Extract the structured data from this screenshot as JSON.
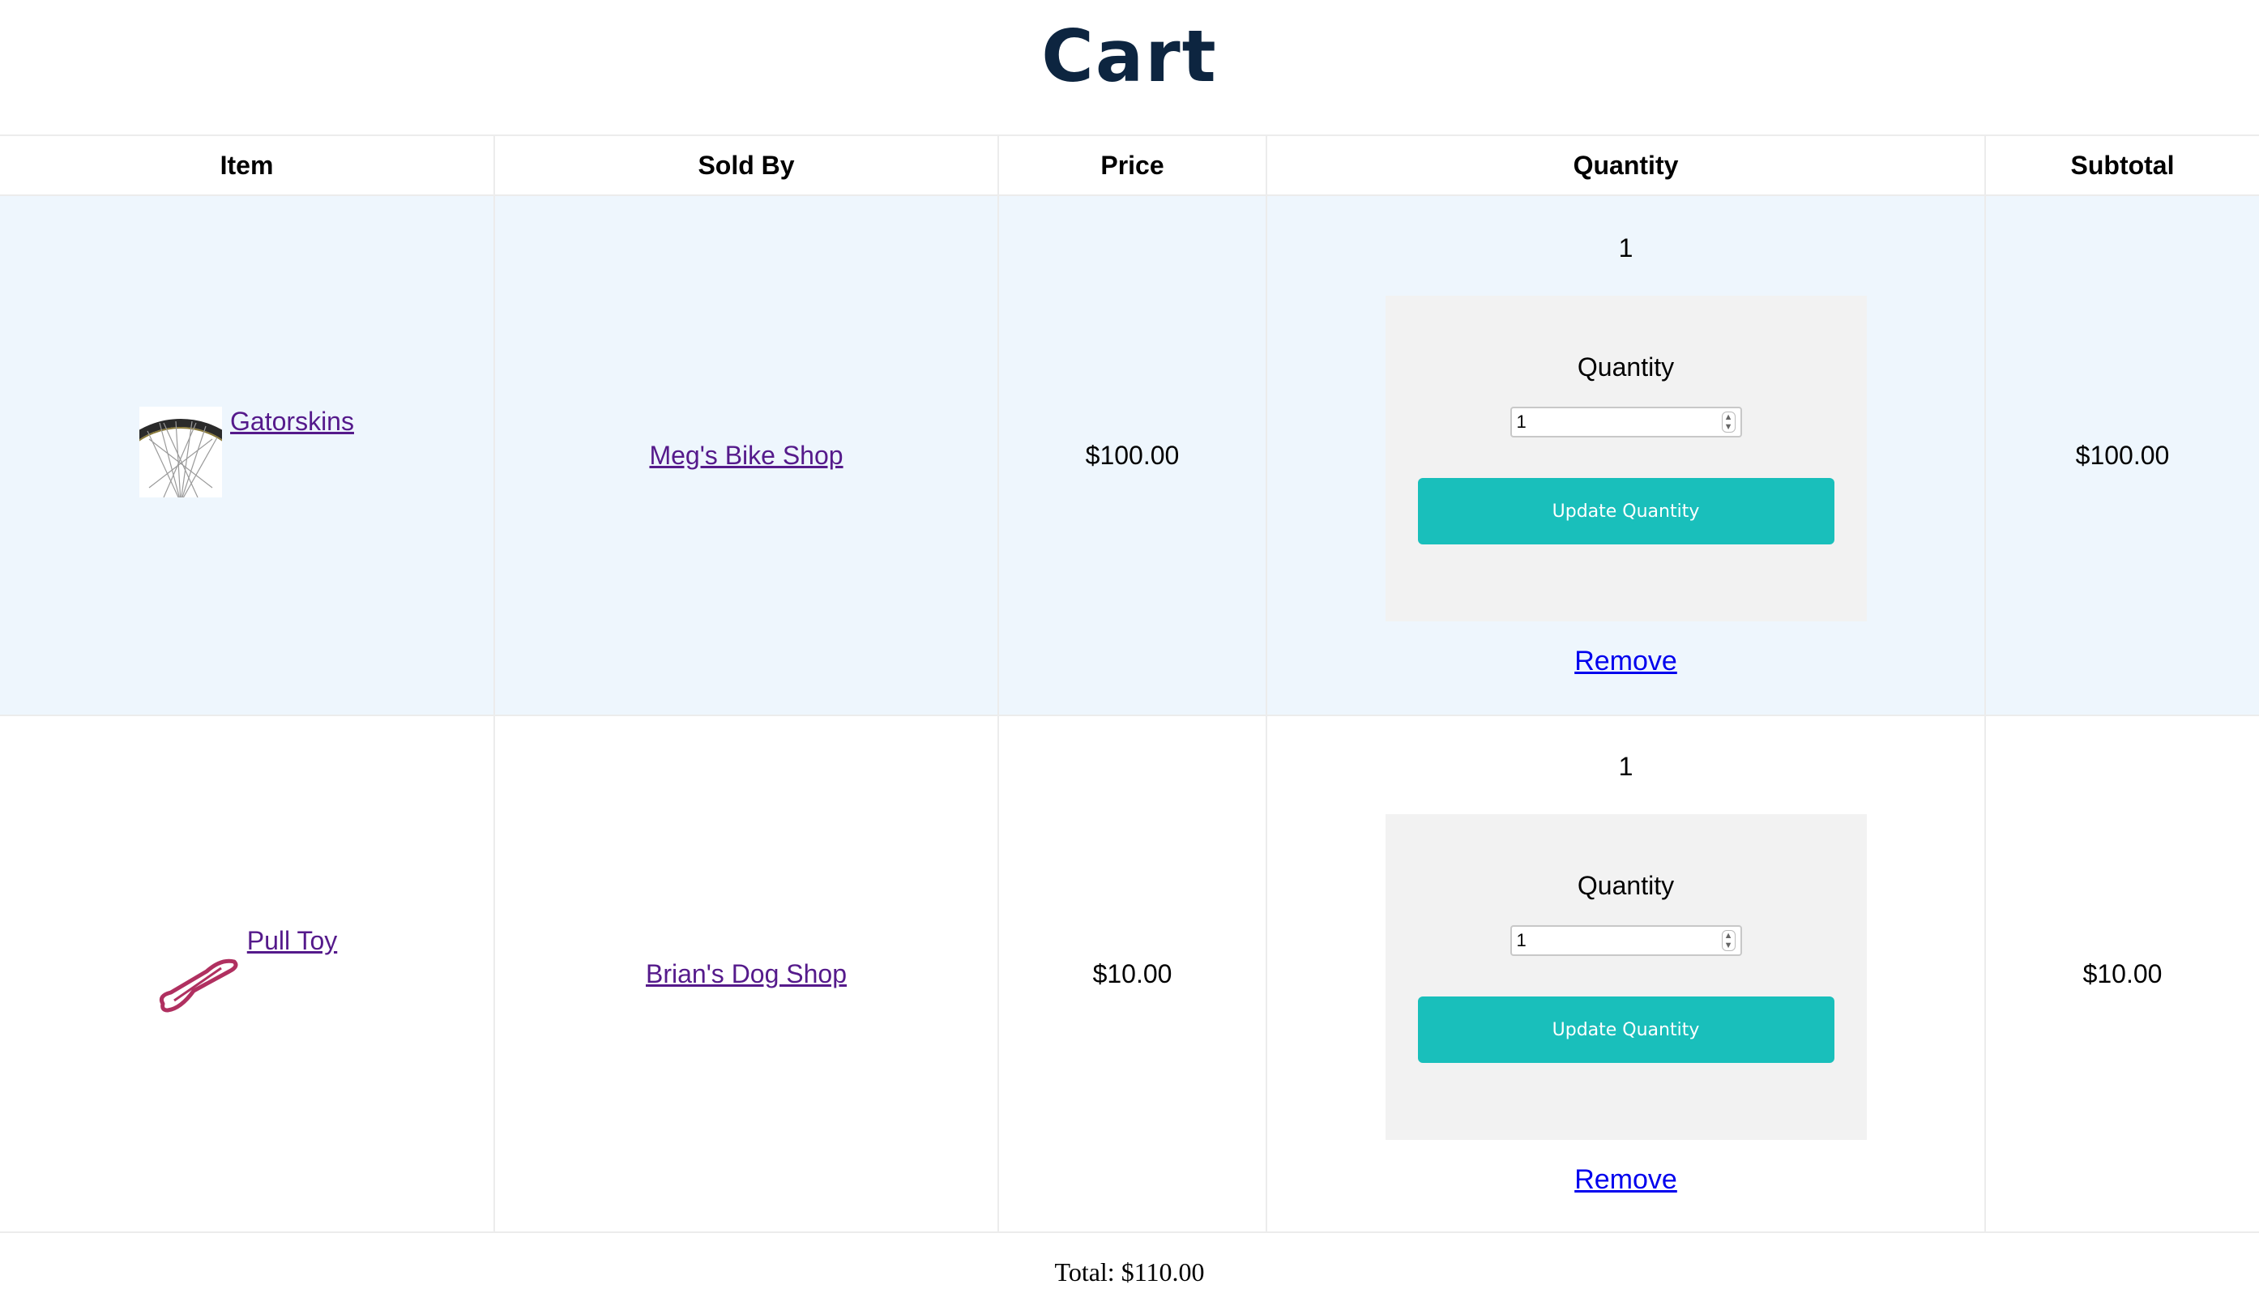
{
  "page": {
    "title": "Cart"
  },
  "table": {
    "headers": [
      "Item",
      "Sold By",
      "Price",
      "Quantity",
      "Subtotal"
    ]
  },
  "rows": [
    {
      "item": "Gatorskins",
      "image": "bike-wheel-image",
      "seller": "Meg's Bike Shop",
      "price": "$100.00",
      "quantity_display": "1",
      "form_label": "Quantity",
      "input_value": "1",
      "update_label": "Update Quantity",
      "remove_label": "Remove",
      "subtotal": "$100.00"
    },
    {
      "item": "Pull Toy",
      "image": "dog-pull-toy-image",
      "seller": "Brian's Dog Shop",
      "price": "$10.00",
      "quantity_display": "1",
      "form_label": "Quantity",
      "input_value": "1",
      "update_label": "Update Quantity",
      "remove_label": "Remove",
      "subtotal": "$10.00"
    }
  ],
  "total": "Total: $110.00",
  "colors": {
    "title": "#0d2540",
    "button": "#19bfbb",
    "row_highlight": "#eef6fd",
    "form_bg": "#f2f2f2",
    "visited_link": "#551a8b",
    "link": "#0000ee"
  }
}
